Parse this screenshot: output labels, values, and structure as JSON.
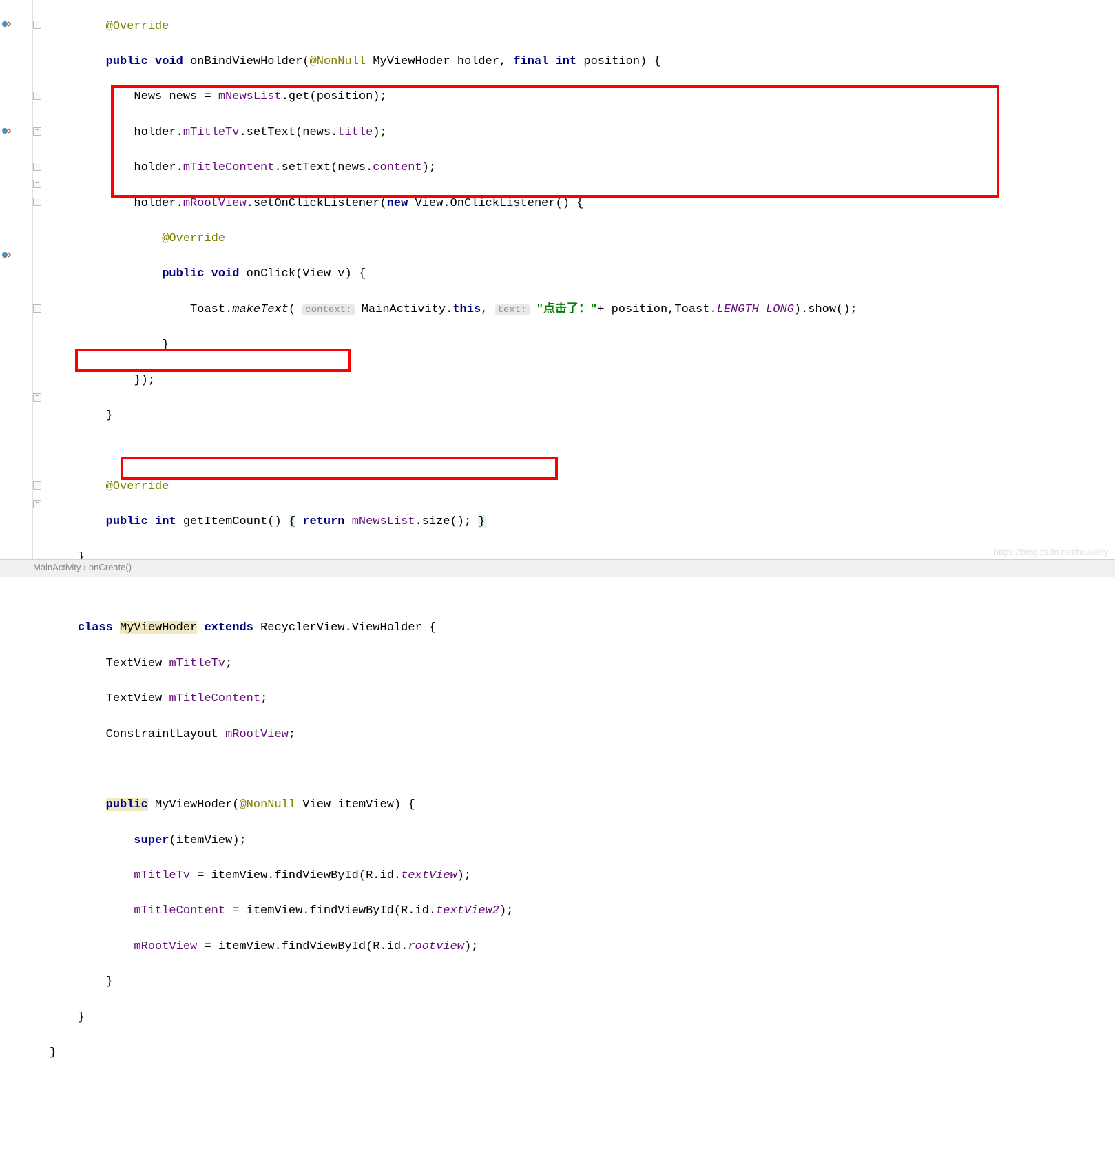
{
  "code": {
    "l1_annotation": "@Override",
    "l2_public": "public",
    "l2_void": "void",
    "l2_method": "onBindViewHolder",
    "l2_nonnull": "@NonNull",
    "l2_type1": "MyViewHoder",
    "l2_param1": "holder",
    "l2_final": "final",
    "l2_int": "int",
    "l2_param2": "position",
    "l3_type": "News",
    "l3_var": "news",
    "l3_field": "mNewsList",
    "l3_call": ".get(position);",
    "l4_pre": "holder.",
    "l4_field": "mTitleTv",
    "l4_mid": ".setText(news.",
    "l4_prop": "title",
    "l4_end": ");",
    "l5_pre": "holder.",
    "l5_field": "mTitleContent",
    "l5_mid": ".setText(news.",
    "l5_prop": "content",
    "l5_end": ");",
    "l6_pre": "holder.",
    "l6_field": "mRootView",
    "l6_mid": ".setOnClickListener(",
    "l6_new": "new",
    "l6_type": " View.OnClickListener() {",
    "l7": "@Override",
    "l8_public": "public",
    "l8_void": "void",
    "l8_method": "onClick",
    "l8_params": "(View v) {",
    "l9_class": "Toast.",
    "l9_make": "makeText",
    "l9_hint1": "context:",
    "l9_ctx": " MainActivity.",
    "l9_this": "this",
    "l9_hint2": "text:",
    "l9_str": " \"点击了：\"",
    "l9_plus": "+ position,Toast.",
    "l9_const": "LENGTH_LONG",
    "l9_end": ").show();",
    "l10": "}",
    "l11": "});",
    "l12": "}",
    "l14": "@Override",
    "l15_public": "public",
    "l15_int": "int",
    "l15_method": "getItemCount",
    "l15_body1": "() ",
    "l15_brace1": "{",
    "l15_return": "return",
    "l15_field": "mNewsList",
    "l15_call": ".size(); ",
    "l15_brace2": "}",
    "l16": "}",
    "l18_class": "class",
    "l18_name": "MyViewHoder",
    "l18_extends": "extends",
    "l18_parent": "RecyclerView.ViewHolder {",
    "l19_type": "TextView",
    "l19_field": "mTitleTv",
    "l20_type": "TextView",
    "l20_field": "mTitleContent",
    "l21_type": "ConstraintLayout",
    "l21_field": "mRootView",
    "l23_public": "public",
    "l23_name": "MyViewHoder",
    "l23_nonnull": "@NonNull",
    "l23_params": " View itemView) {",
    "l24_super": "super",
    "l24_rest": "(itemView);",
    "l25_field": "mTitleTv",
    "l25_mid": " = itemView.findViewById(R.id.",
    "l25_id": "textView",
    "l25_end": ");",
    "l26_field": "mTitleContent",
    "l26_mid": " = itemView.findViewById(R.id.",
    "l26_id": "textView2",
    "l26_end": ");",
    "l27_field": "mRootView",
    "l27_mid": " = itemView.findViewById(R.id.",
    "l27_id": "rootview",
    "l27_end": ");",
    "l28": "}",
    "l29": "}",
    "l30": "}"
  },
  "breadcrumb": {
    "item1": "MainActivity",
    "sep": "›",
    "item2": "onCreate()"
  },
  "watermark": "https://blog.csdn.net/huweilly"
}
